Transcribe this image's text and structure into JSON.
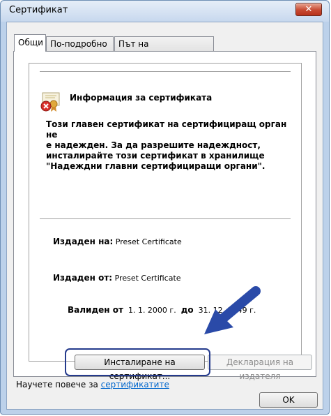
{
  "window": {
    "title": "Сертификат",
    "close_glyph": "✕"
  },
  "tabs": [
    {
      "label": "Общи"
    },
    {
      "label": "По-подробно"
    },
    {
      "label": "Път на сертифициране"
    }
  ],
  "info": {
    "title": "Информация за сертификата",
    "warning": "Този главен сертификат на сертифициращ орган не\nе надежден. За да разрешите надеждност,\nинсталирайте този сертификат в хранилище\n\"Надеждни главни сертифициращи органи\".",
    "issued_to_label": "Издаден на:",
    "issued_to_value": "Preset Certificate",
    "issued_by_label": "Издаден от:",
    "issued_by_value": "Preset Certificate",
    "valid_label": "Валиден от",
    "valid_from": "1. 1. 2000 г.",
    "valid_to_label": "до",
    "valid_to": "31. 12. 2049 г."
  },
  "buttons": {
    "install": "Инсталиране на сертификат...",
    "issuer_statement": "Декларация на издателя",
    "ok": "OK"
  },
  "learn_more": {
    "prefix": "Научете повече за ",
    "link": "сертификатите"
  },
  "colors": {
    "annotation_arrow": "#2a4aa8",
    "highlight_border": "#243a8c"
  }
}
